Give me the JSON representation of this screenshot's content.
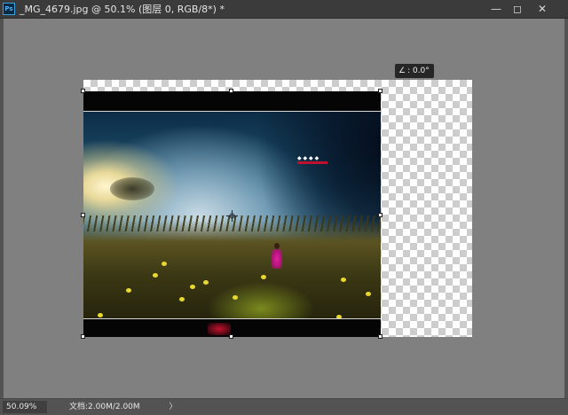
{
  "app": {
    "icon_text": "Ps"
  },
  "document": {
    "title": "_MG_4679.jpg @ 50.1% (图层 0, RGB/8*) *"
  },
  "window_controls": {
    "minimize": "—",
    "restore": "◻",
    "close": "✕"
  },
  "transform": {
    "angle_icon": "∠",
    "angle_label": ": 0.0°"
  },
  "image": {
    "watermark_text": "◆ ◆ ◆ ◆"
  },
  "status": {
    "zoom": "50.09%",
    "doc_info": "文档:2.00M/2.00M",
    "menu_arrow": "〉"
  },
  "colors": {
    "pasteboard": "#808080",
    "chrome": "#535353",
    "titlebar": "#3b3b3b"
  }
}
